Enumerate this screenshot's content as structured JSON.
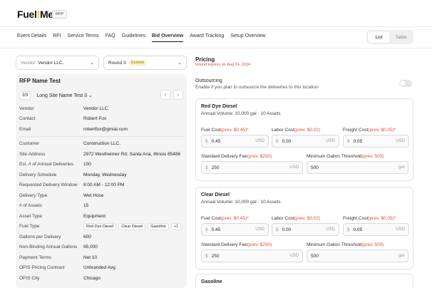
{
  "app": {
    "logo_text": "Fuel",
    "logo_bang": "!",
    "logo_tail": "Me",
    "badge": "RFP"
  },
  "nav": [
    "Event Details",
    "RFI",
    "Service Terms",
    "FAQ",
    "Guidelines",
    "Bid Overview",
    "Award Tracking",
    "Setup Overview"
  ],
  "nav_active": 5,
  "view_toggle": {
    "list": "List",
    "table": "Table"
  },
  "vendor_select": {
    "label": "Vendor:",
    "value": "Vendor LLC."
  },
  "round_select": {
    "value": "Round 3",
    "badge": "Current"
  },
  "rfp": {
    "title": "RFP Name Test",
    "site_index": "3/3",
    "site_name": "Long Site Name Test 3",
    "prev_btn": "‹",
    "next_btn": "›",
    "vendor_info": [
      {
        "k": "Vendor",
        "v": "Vendor LLC."
      },
      {
        "k": "Contact",
        "v": "Robert Fox"
      },
      {
        "k": "Email",
        "v": "robertfox@gmial.com"
      }
    ],
    "details": [
      {
        "k": "Customer",
        "v": "Construction LLC."
      },
      {
        "k": "Site Address",
        "v": "2972 Westheimer Rd. Santa Ana, Illinois 85486"
      },
      {
        "k": "Est. # of Annual Deliveries",
        "v": "100"
      },
      {
        "k": "Delivery Schedule",
        "v": "Monday, Wednesday"
      },
      {
        "k": "Requested Delivery Window",
        "v": "8:00 AM - 12:00 PM"
      },
      {
        "k": "Delivery Type",
        "v": "Wet Hose"
      },
      {
        "k": "# of Assets",
        "v": "15"
      },
      {
        "k": "Asset Type",
        "v": "Equipment"
      },
      {
        "k": "Fuel Type",
        "v": ""
      },
      {
        "k": "Gallons per Delivery",
        "v": "600"
      },
      {
        "k": "Non-Binding Annual Gallons",
        "v": "95,000"
      },
      {
        "k": "Payment Terms",
        "v": "Net 10"
      },
      {
        "k": "OPIS Pricing Contract",
        "v": "Unbranded Avg."
      },
      {
        "k": "OPIS City",
        "v": "Chicago"
      }
    ],
    "fuel_chips": [
      "Red Dye Diesel",
      "Clear Diesel",
      "Gasoline",
      "+1"
    ]
  },
  "pricing": {
    "title": "Pricing",
    "round_expires": "Round expires on Aug 24, 2024",
    "outsourcing_title": "Outsourcing",
    "outsourcing_desc": "Enable if you plan to outsource the deliveries to this location"
  },
  "fuels": [
    {
      "name": "Red Dye Diesel",
      "volume": "Annual Volume: 10,000 gal  ·  10 Assets",
      "fuel_cost_label": "Fuel Cost",
      "fuel_cost_prev": "(prev. $0.45)*",
      "fuel_cost": "0.45",
      "labor_cost_label": "Labor Cost",
      "labor_cost_prev": "(prev. $0.02)",
      "labor_cost": "0.00",
      "freight_cost_label": "Freight Cost",
      "freight_cost_prev": "(prev. $0.05)*",
      "freight_cost": "0.05",
      "delivery_fee_label": "Standard Delivery Fee",
      "delivery_fee_prev": "(prev. $250)",
      "delivery_fee": "250",
      "min_gallon_label": "Minimum Gallon Threshold",
      "min_gallon_prev": "(prev. 500)",
      "min_gallon": "500"
    },
    {
      "name": "Clear Diesel",
      "volume": "Annual Volume: 10,000 gal  ·  10 Assets",
      "fuel_cost_label": "Fuel Cost",
      "fuel_cost_prev": "(prev. $0.45)*",
      "fuel_cost": "0.45",
      "labor_cost_label": "Labor Cost",
      "labor_cost_prev": "(prev. $0.02)",
      "labor_cost": "0.00",
      "freight_cost_label": "Freight Cost",
      "freight_cost_prev": "(prev. $0.05)*",
      "freight_cost": "0.05",
      "delivery_fee_label": "Standard Delivery Fee",
      "delivery_fee_prev": "(prev. $250)",
      "delivery_fee": "250",
      "min_gallon_label": "Minimum Gallon Threshold",
      "min_gallon_prev": "(prev. 500)",
      "min_gallon": "500"
    },
    {
      "name": "Gasoline"
    }
  ],
  "units": {
    "currency": "$",
    "usd": "USD",
    "gal": "gal"
  }
}
